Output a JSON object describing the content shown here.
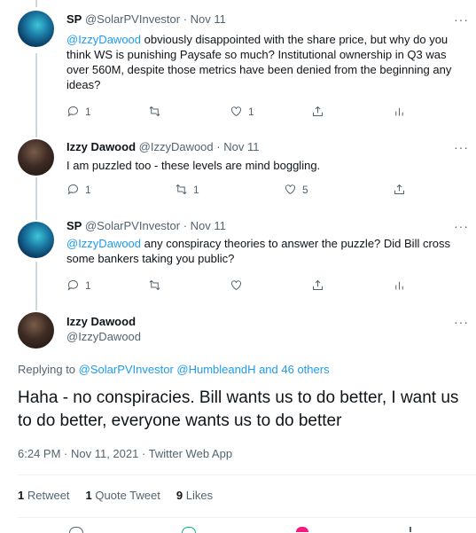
{
  "tweets": [
    {
      "name": "SP",
      "handle": "@SolarPVInvestor",
      "time": "Nov 11",
      "mention": "@IzzyDawood",
      "text": " obviously disappointed with the share price, but why do you think WS is punishing Paysafe so much? Institutional ownership in Q3 was over 560M, despite those metrics have been denied from the beginning any ideas?",
      "reply_count": "1",
      "retweet_count": "",
      "like_count": "1"
    },
    {
      "name": "Izzy Dawood",
      "handle": "@IzzyDawood",
      "time": "Nov 11",
      "text": "I am puzzled too - these levels are mind boggling.",
      "reply_count": "1",
      "retweet_count": "1",
      "like_count": "5"
    },
    {
      "name": "SP",
      "handle": "@SolarPVInvestor",
      "time": "Nov 11",
      "mention": "@IzzyDawood",
      "text": " any conspiracy theories to answer the puzzle? Did Bill cross some bankers taking you public?",
      "reply_count": "1",
      "retweet_count": "",
      "like_count": ""
    }
  ],
  "main": {
    "name": "Izzy Dawood",
    "handle": "@IzzyDawood",
    "replying_prefix": "Replying to ",
    "replying_to": "@SolarPVInvestor @HumbleandH and 46 others",
    "text": "Haha - no conspiracies.  Bill wants us to do better, I want us to do better, everyone wants us to do better",
    "timestamp": "6:24 PM · Nov 11, 2021 · Twitter Web App",
    "retweets_num": "1",
    "retweets_label": " Retweet",
    "quotes_num": "1",
    "quotes_label": " Quote Tweet",
    "likes_num": "9",
    "likes_label": " Likes"
  },
  "separator": " · ",
  "more": "···",
  "colors": {
    "link": "#1d9bf0",
    "muted": "#536471",
    "text": "#0f1419"
  },
  "icons": [
    "reply-icon",
    "retweet-icon",
    "like-icon",
    "share-icon",
    "analytics-icon",
    "more-icon"
  ]
}
